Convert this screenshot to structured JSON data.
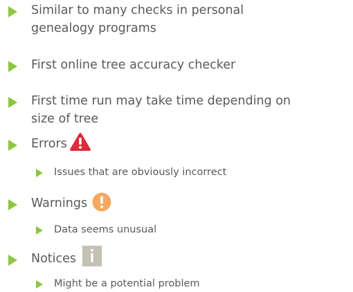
{
  "bullets": [
    {
      "lines": [
        "Similar to many checks in personal",
        "genealogy programs"
      ]
    },
    {
      "lines": [
        "First online tree accuracy checker"
      ]
    },
    {
      "lines": [
        "First time run may take time depending on",
        "size of tree"
      ]
    },
    {
      "label": "Errors",
      "icon": "error-warning-triangle-icon"
    },
    {
      "sub": "Issues that are obviously incorrect"
    },
    {
      "label": "Warnings",
      "icon": "warning-exclamation-circle-icon"
    },
    {
      "sub": "Data seems unusual"
    },
    {
      "label": "Notices",
      "icon": "info-square-icon"
    },
    {
      "sub": "Might be a potential problem"
    }
  ],
  "colors": {
    "bullet": "#8cc63f",
    "text": "#595959",
    "error": "#e0293a",
    "warning": "#f5a861",
    "notice": "#c4c0b3"
  }
}
